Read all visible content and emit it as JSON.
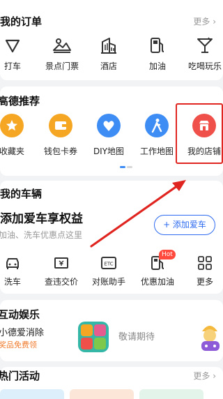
{
  "orders": {
    "title": "我的订单",
    "more": "更多",
    "items": [
      {
        "label": "打车",
        "icon": "taxi-icon"
      },
      {
        "label": "景点门票",
        "icon": "scenic-ticket-icon"
      },
      {
        "label": "酒店",
        "icon": "hotel-icon"
      },
      {
        "label": "加油",
        "icon": "fuel-icon"
      },
      {
        "label": "吃喝玩乐",
        "icon": "cocktail-icon"
      }
    ]
  },
  "recommend": {
    "title": "高德推荐",
    "items": [
      {
        "label": "收藏夹",
        "icon": "star-icon",
        "color": "#f5a623"
      },
      {
        "label": "钱包卡券",
        "icon": "wallet-icon",
        "color": "#f5a623"
      },
      {
        "label": "DIY地图",
        "icon": "heart-map-icon",
        "color": "#3d8df5"
      },
      {
        "label": "工作地图",
        "icon": "walker-icon",
        "color": "#3d8df5"
      },
      {
        "label": "我的店铺",
        "icon": "shop-icon",
        "color": "#f0504a"
      }
    ]
  },
  "vehicle": {
    "title": "我的车辆",
    "headline": "添加爱车享权益",
    "subtitle": "加油、洗车优惠点这里",
    "add_button": "+ 添加爱车",
    "items": [
      {
        "label": "洗车",
        "icon": "car-wash-icon"
      },
      {
        "label": "查违交价",
        "icon": "ticket-icon"
      },
      {
        "label": "对账助手",
        "icon": "etc-icon"
      },
      {
        "label": "优惠加油",
        "icon": "fuel-discount-icon"
      },
      {
        "label": "更多",
        "icon": "grid-more-icon"
      }
    ],
    "hot_badge": "Hot"
  },
  "entertainment": {
    "title": "互动娱乐",
    "game_name": "小德爱消除",
    "game_prize": "奖品免费领",
    "coming_soon": "敬请期待"
  },
  "activities": {
    "title": "热门活动",
    "more": "更多"
  },
  "colors": {
    "accent": "#2e6bf0",
    "highlight": "#e0241f",
    "prize": "#f07a2b"
  }
}
